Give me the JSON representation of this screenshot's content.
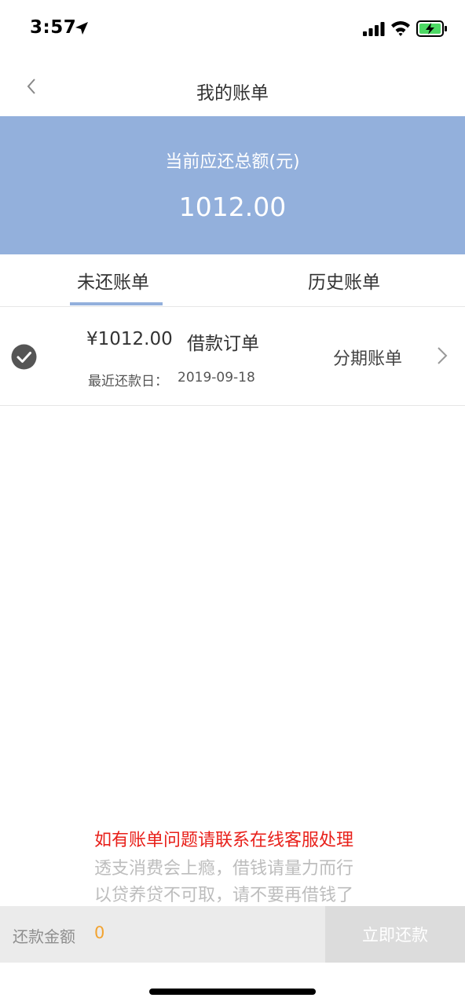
{
  "status_bar": {
    "time": "3:57"
  },
  "nav": {
    "title": "我的账单"
  },
  "summary": {
    "label": "当前应还总额(元)",
    "amount": "1012.00"
  },
  "tabs": [
    {
      "label": "未还账单",
      "active": true
    },
    {
      "label": "历史账单",
      "active": false
    }
  ],
  "bill": {
    "amount": "¥1012.00",
    "type": "借款订单",
    "date_label": "最近还款日：",
    "date": "2019-09-18",
    "action": "分期账单"
  },
  "notices": {
    "red": "如有账单问题请联系在线客服处理",
    "gray1": "透支消费会上瘾，借钱请量力而行",
    "gray2": "以贷养贷不可取，请不要再借钱了"
  },
  "payment": {
    "label": "还款金额",
    "value": "0",
    "button": "立即还款"
  },
  "colors": {
    "accent": "#93b0dc",
    "notice_red": "#e8201a",
    "amount_orange": "#f2a330",
    "battery_green": "#4cd964"
  }
}
